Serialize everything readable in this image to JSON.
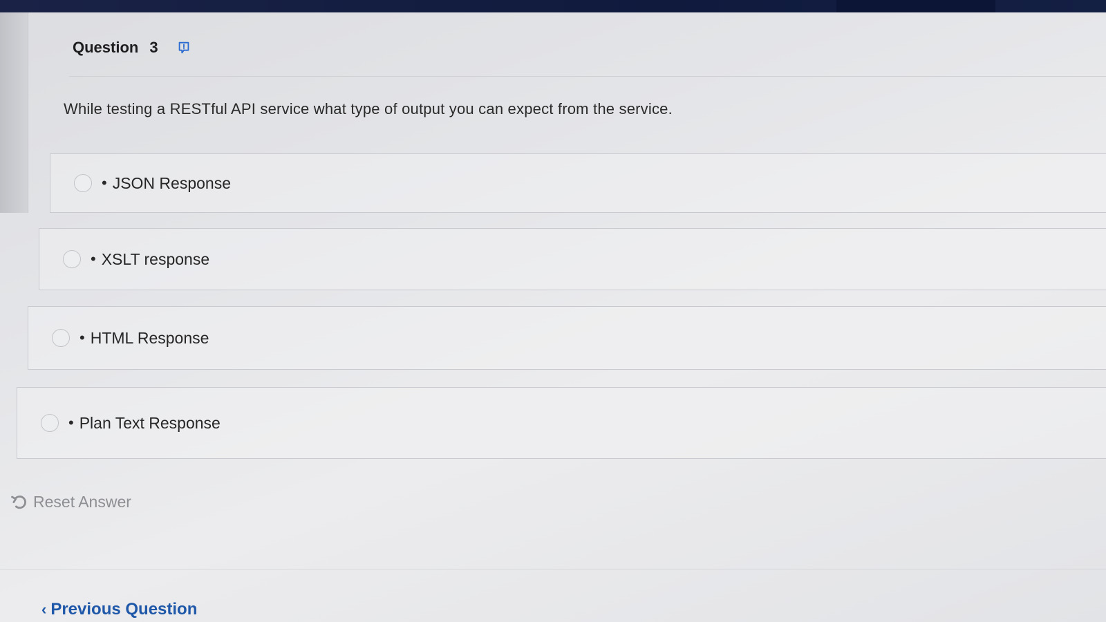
{
  "question": {
    "label": "Question",
    "number": "3",
    "text": "While testing a RESTful API service what type of output you can expect from the service."
  },
  "options": [
    {
      "bullet": "•",
      "label": "JSON Response"
    },
    {
      "bullet": "•",
      "label": "XSLT response"
    },
    {
      "bullet": "•",
      "label": "HTML Response"
    },
    {
      "bullet": "•",
      "label": "Plan Text Response"
    }
  ],
  "actions": {
    "reset_label": "Reset Answer",
    "previous_label": "Previous Question",
    "previous_chevron": "‹"
  },
  "icons": {
    "flag": "flag-icon",
    "reset": "undo-icon"
  },
  "colors": {
    "top_bar": "#0f1a3d",
    "link": "#1f58a8",
    "flag_icon": "#2a6bd1",
    "muted_text": "#8e8f93"
  }
}
